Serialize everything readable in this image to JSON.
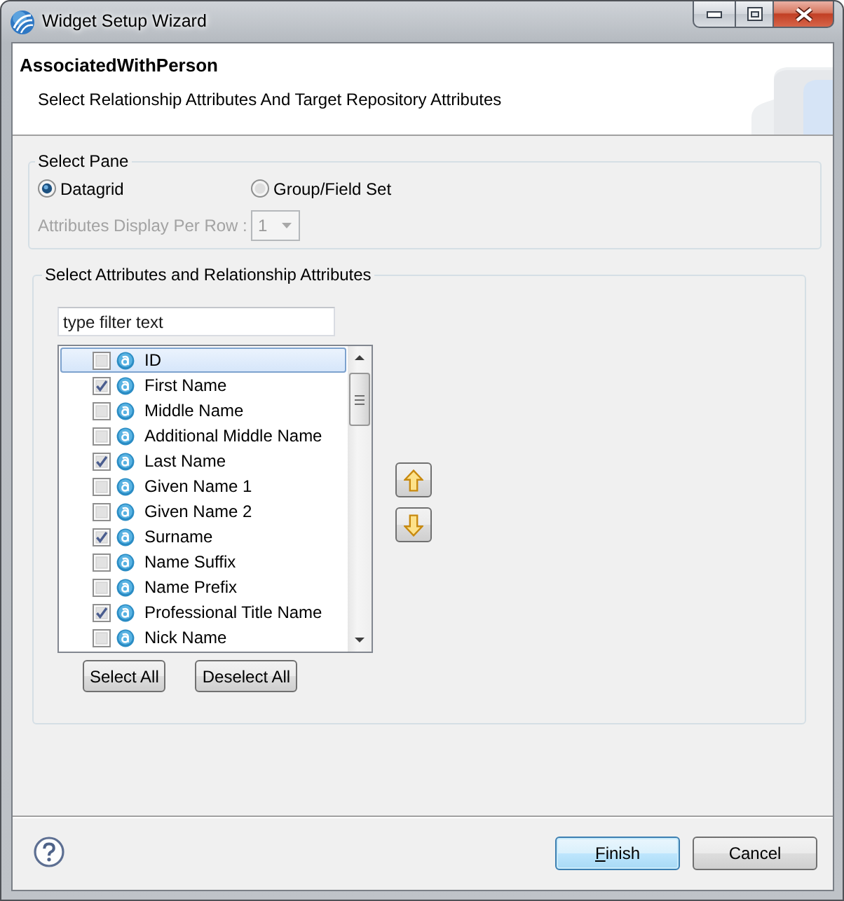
{
  "window": {
    "title": "Widget Setup Wizard"
  },
  "header": {
    "title": "AssociatedWithPerson",
    "description": "Select Relationship Attributes And Target Repository Attributes"
  },
  "select_pane": {
    "legend": "Select Pane",
    "options": [
      {
        "label": "Datagrid",
        "selected": true
      },
      {
        "label": "Group/Field Set",
        "selected": false
      }
    ],
    "per_row": {
      "label": "Attributes Display Per Row :",
      "value": "1",
      "disabled": true
    }
  },
  "attributes": {
    "legend": "Select Attributes and Relationship Attributes",
    "filter": {
      "placeholder": "type filter text"
    },
    "items": [
      {
        "name": "ID",
        "checked": false,
        "selected": true
      },
      {
        "name": "First Name",
        "checked": true,
        "selected": false
      },
      {
        "name": "Middle Name",
        "checked": false,
        "selected": false
      },
      {
        "name": "Additional Middle Name",
        "checked": false,
        "selected": false
      },
      {
        "name": "Last Name",
        "checked": true,
        "selected": false
      },
      {
        "name": "Given Name 1",
        "checked": false,
        "selected": false
      },
      {
        "name": "Given Name 2",
        "checked": false,
        "selected": false
      },
      {
        "name": "Surname",
        "checked": true,
        "selected": false
      },
      {
        "name": "Name Suffix",
        "checked": false,
        "selected": false
      },
      {
        "name": "Name Prefix",
        "checked": false,
        "selected": false
      },
      {
        "name": "Professional Title Name",
        "checked": true,
        "selected": false
      },
      {
        "name": "Nick Name",
        "checked": false,
        "selected": false
      }
    ],
    "buttons": [
      "Select All",
      "Deselect All"
    ]
  },
  "footer": {
    "buttons": [
      {
        "label": "Finish",
        "default": true,
        "mnemonic": true
      },
      {
        "label": "Cancel",
        "default": false,
        "mnemonic": false
      }
    ]
  }
}
